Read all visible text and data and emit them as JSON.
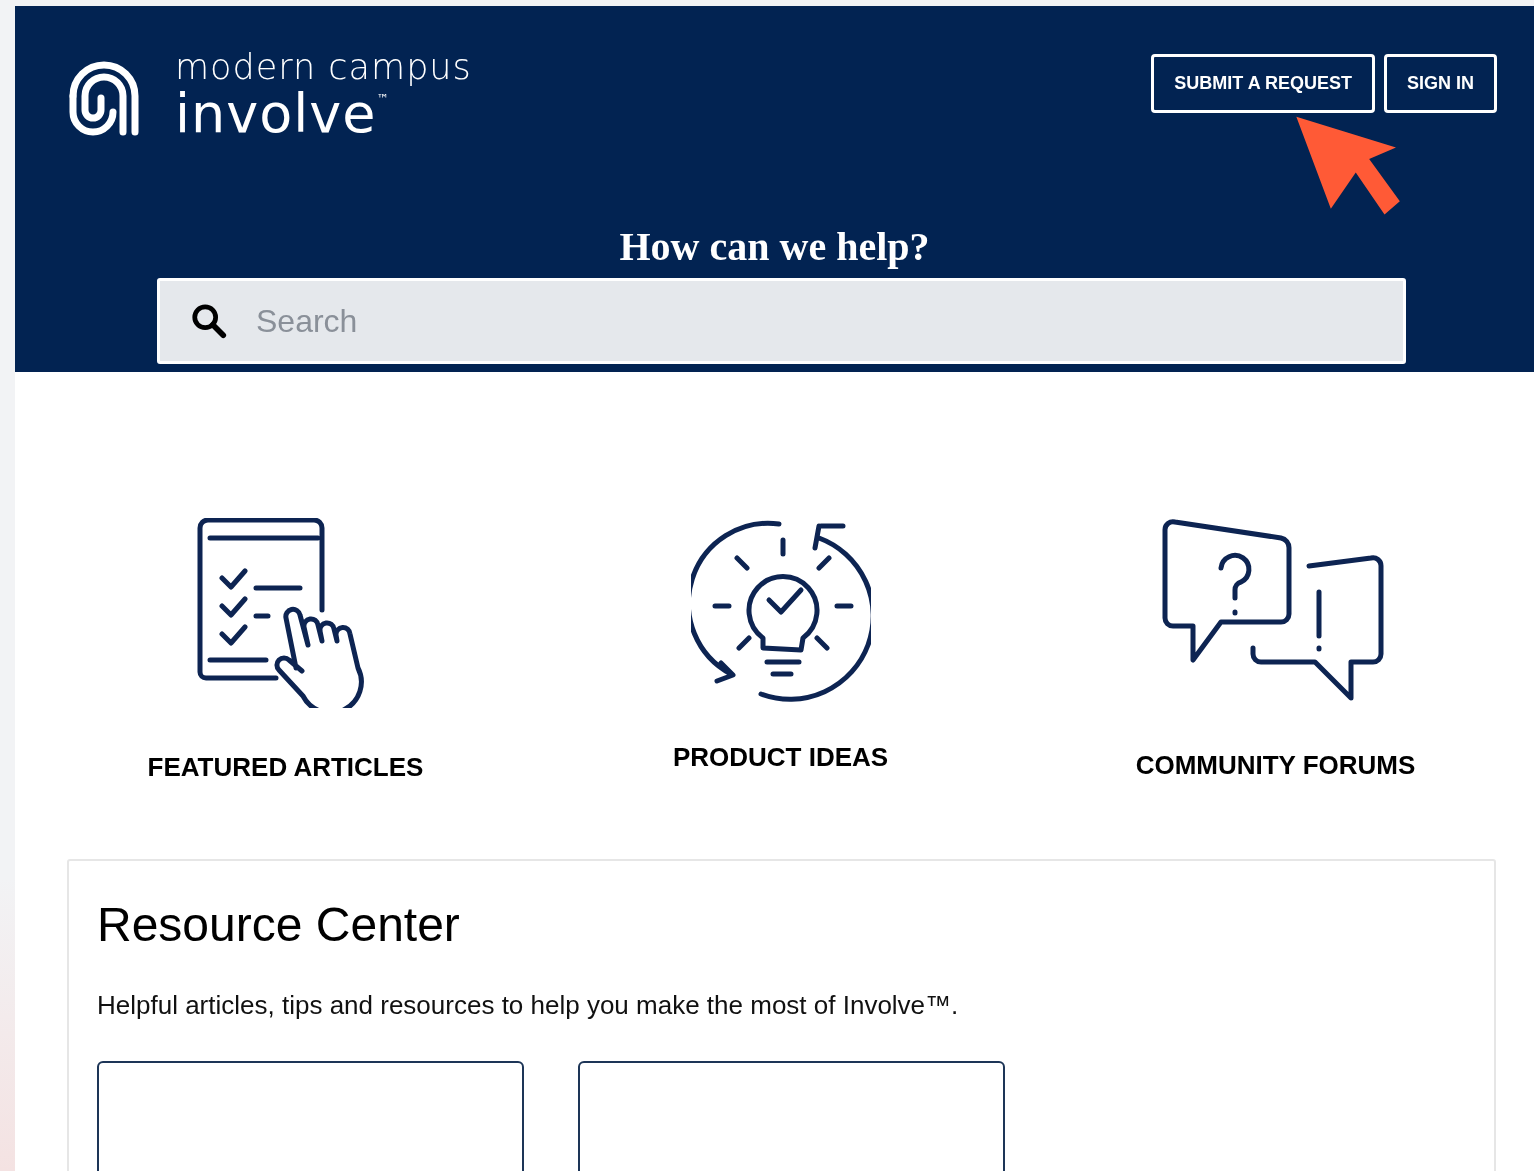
{
  "header": {
    "logo": {
      "line_1": "modern campus",
      "line_2": "involve$^{™}$"
    },
    "buttons": [
      "SUBMIT A REQUEST",
      "SIGN IN"
    ],
    "heading": "How can we help?",
    "search": {
      "placeholder": "Search"
    }
  },
  "features": [
    {
      "kind": "checklist",
      "label": "FEATURED ARTICLES"
    },
    {
      "kind": "idea",
      "label": "PRODUCT IDEAS"
    },
    {
      "kind": "chat",
      "label": "COMMUNITY FORUMS"
    }
  ],
  "resource_center": {
    "title": "Resource Center",
    "description": "Helpful articles, tips and resources to help you make the most of Involve™."
  }
}
